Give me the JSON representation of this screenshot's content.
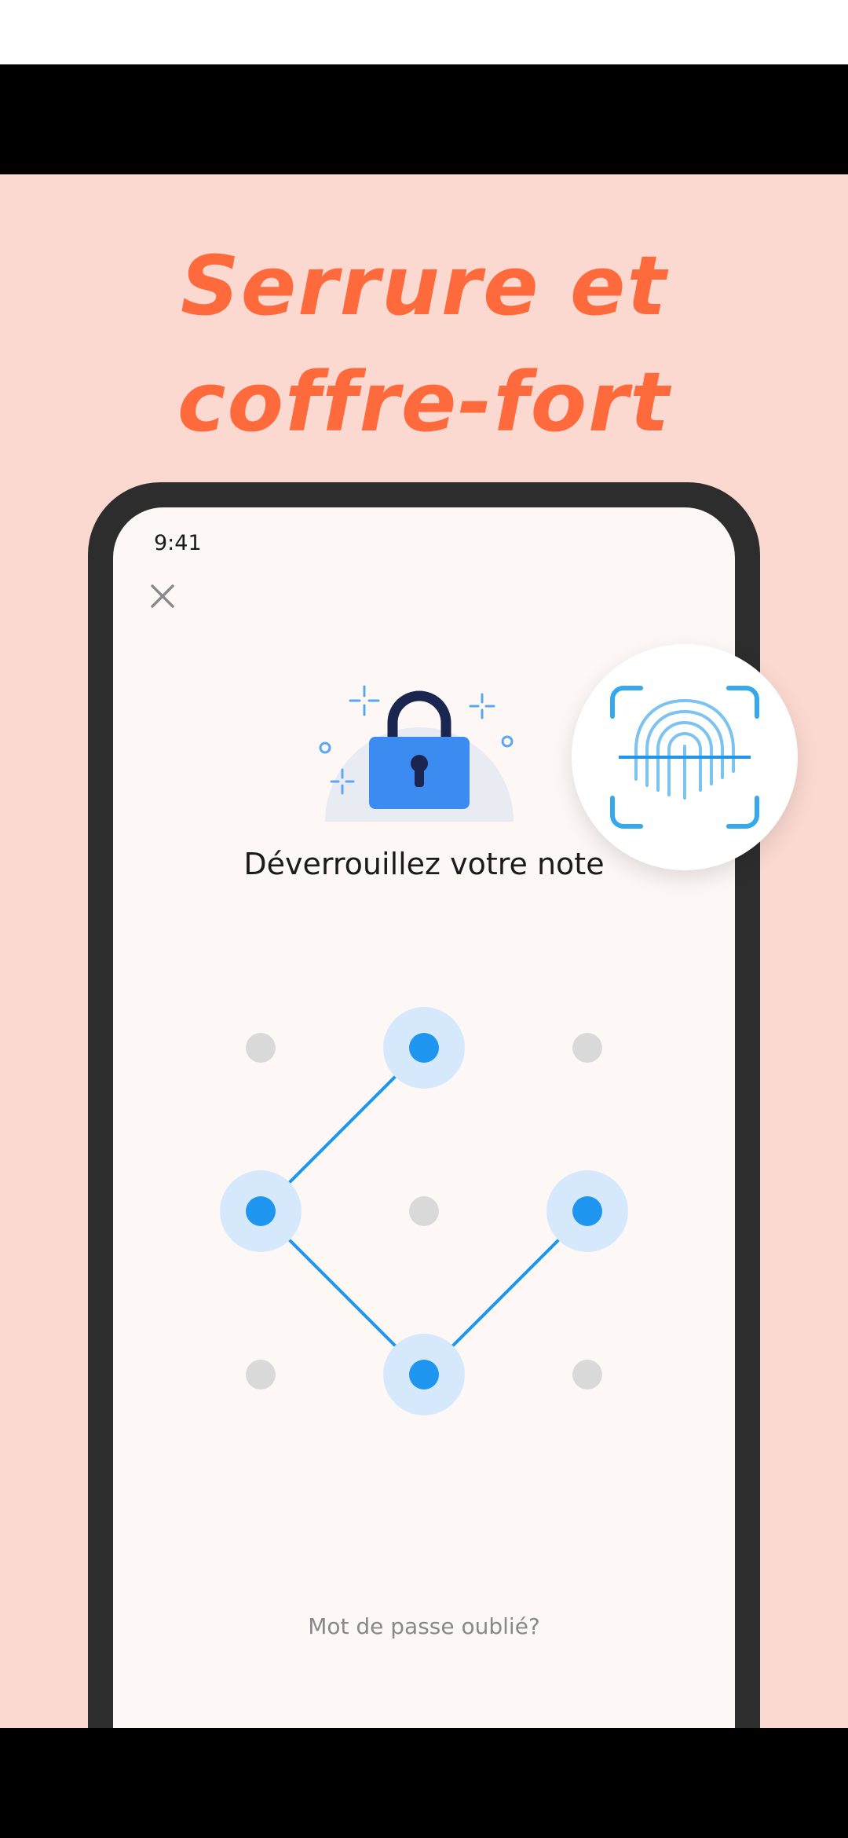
{
  "promo": {
    "title_line1": "Serrure et",
    "title_line2": "coffre-fort"
  },
  "phone": {
    "status_time": "9:41",
    "close_icon": "close-icon",
    "illustration_icon": "padlock-icon",
    "unlock_title": "Déverrouillez votre note",
    "forgot_password": "Mot de passe oublié?",
    "pattern": {
      "grid": [
        3,
        3
      ],
      "selected_sequence": [
        2,
        4,
        8,
        6
      ],
      "selected_labels": [
        "top-center",
        "middle-left",
        "bottom-center",
        "middle-right"
      ]
    }
  },
  "fingerprint_badge": {
    "icon": "fingerprint-icon"
  },
  "colors": {
    "promo_bg": "#fbd9d1",
    "title_orange": "#ff6a3d",
    "accent_blue": "#1e96f0",
    "dot_gray": "#d9d9d9",
    "phone_frame": "#2d2d2d",
    "screen_bg": "#fdf8f6"
  }
}
